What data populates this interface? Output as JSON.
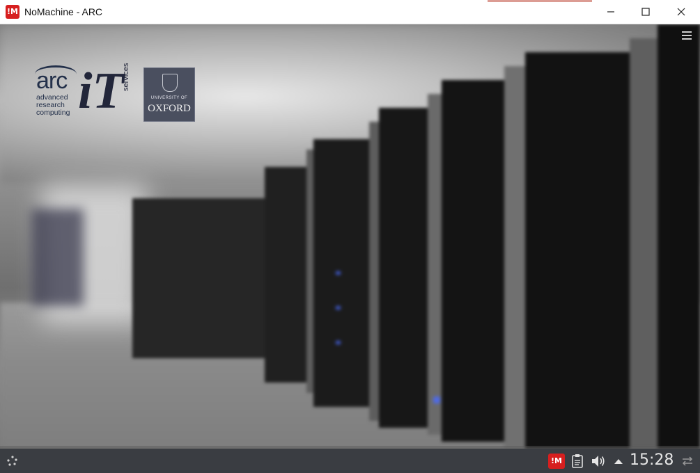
{
  "window": {
    "title": "NoMachine - ARC",
    "app_icon_text": "!M"
  },
  "desktop": {
    "logo": {
      "arc": "arc",
      "arc_subtitle": "advanced\nresearch\ncomputing",
      "it": "iT",
      "services": "services",
      "oxford_small": "UNIVERSITY OF",
      "oxford": "OXFORD"
    }
  },
  "taskbar": {
    "tray_nomachine_text": "!M",
    "clock": "15:28"
  },
  "colors": {
    "nomachine_red": "#d71f1f",
    "taskbar_bg": "#3a3d42",
    "logo_navy": "#23304a"
  }
}
